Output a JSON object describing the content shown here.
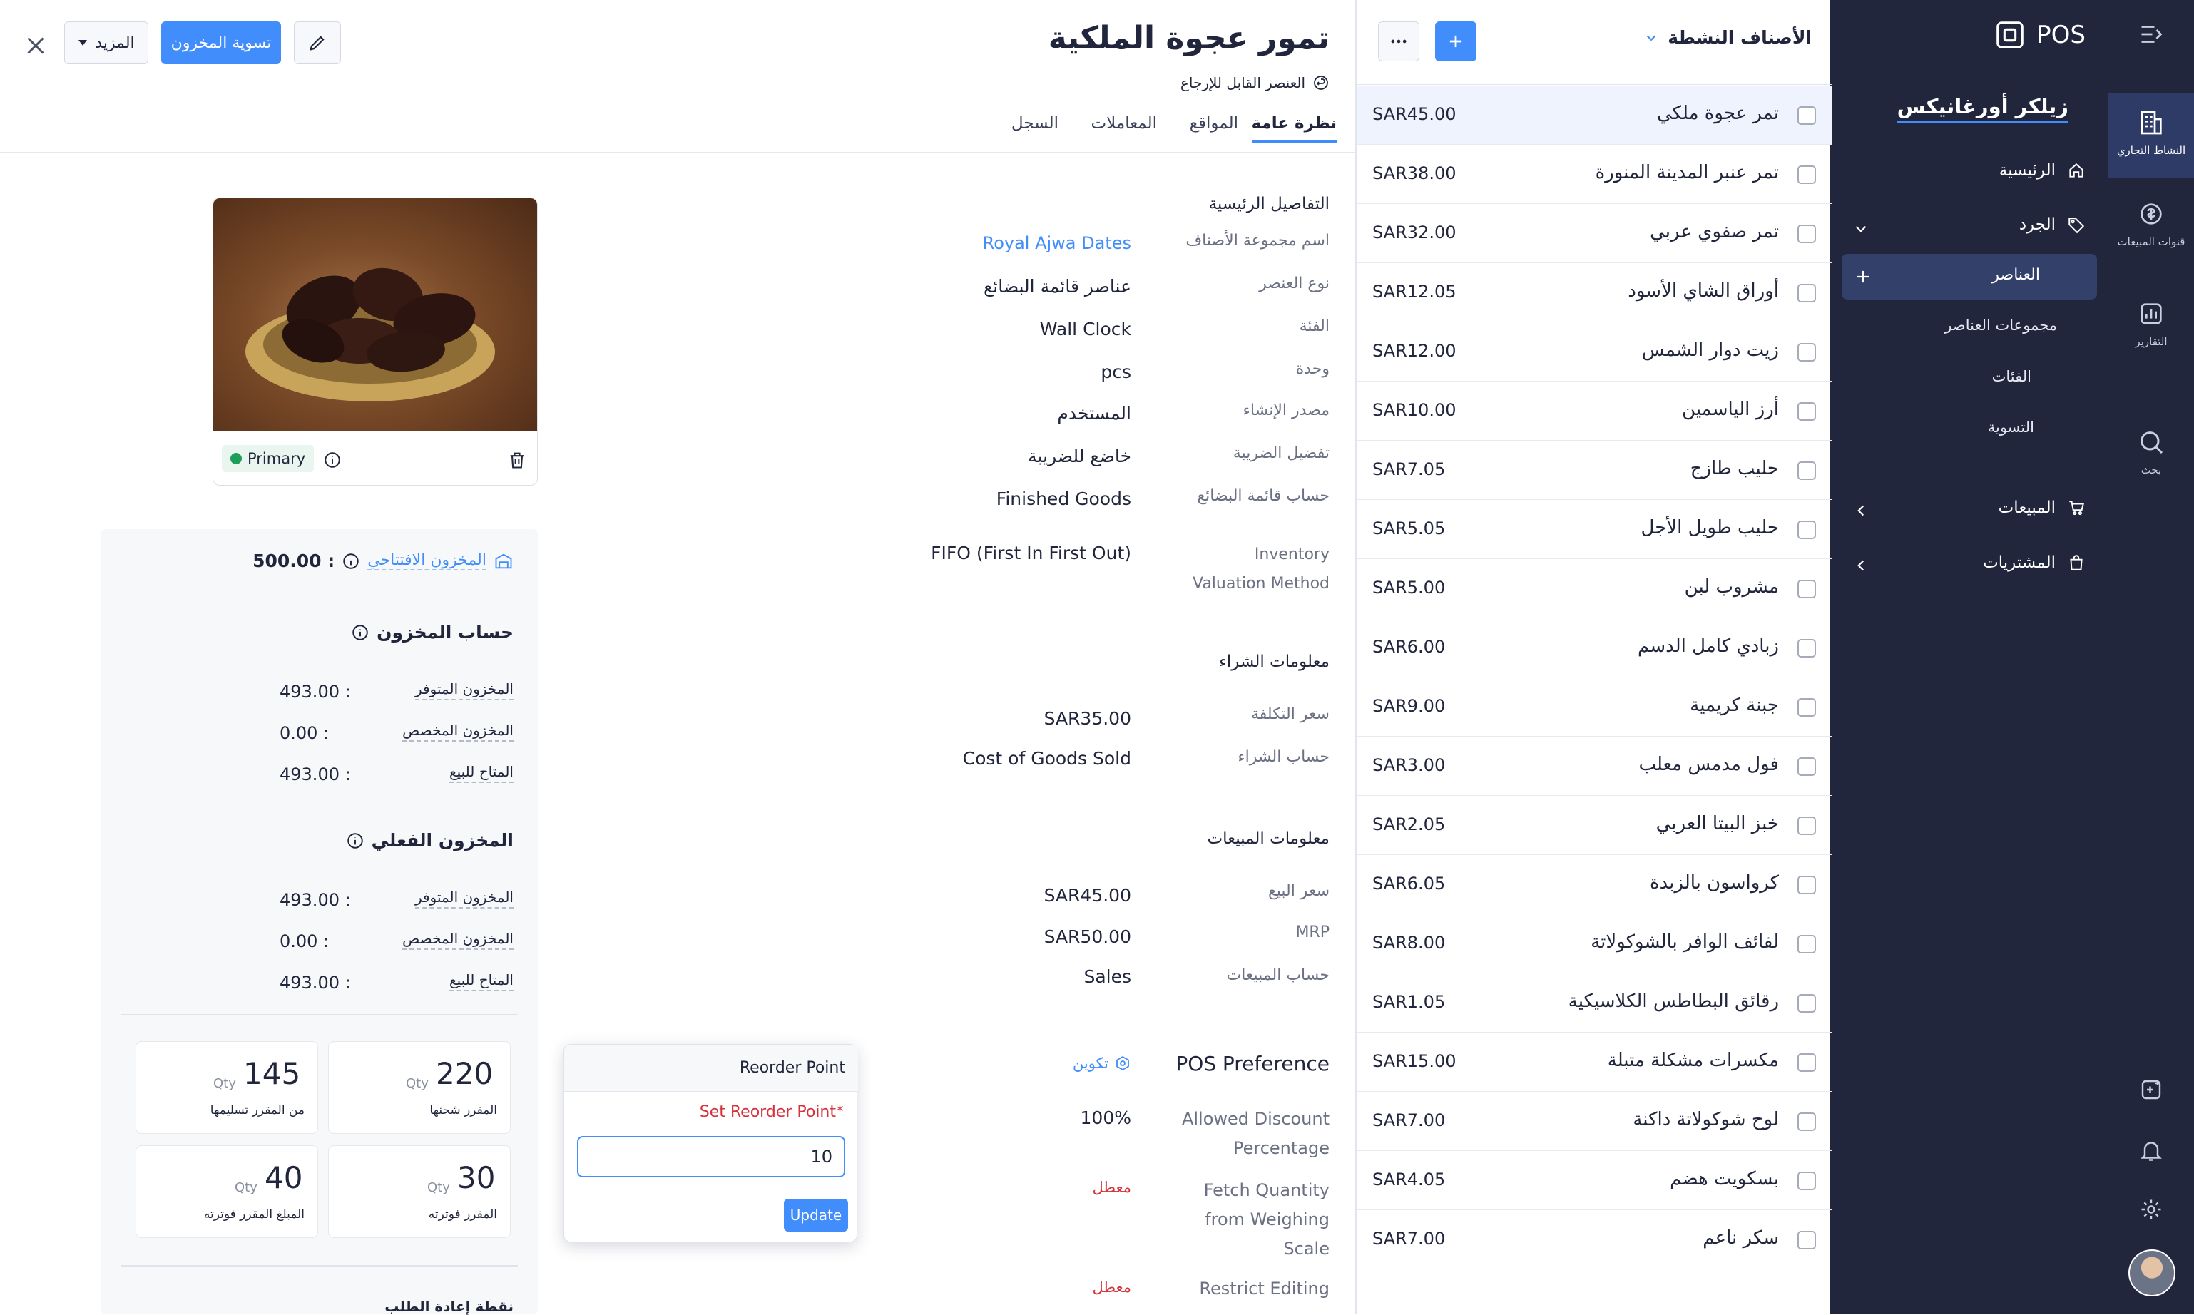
{
  "rail": {
    "items": [
      {
        "label": "النشاط التجاري",
        "icon": "building-icon"
      },
      {
        "label": "قنوات المبيعات",
        "icon": "sales-channel-icon"
      },
      {
        "label": "التقارير",
        "icon": "report-icon"
      },
      {
        "label": "بحث",
        "icon": "search-icon"
      }
    ]
  },
  "nav": {
    "logo": "POS",
    "org": "زيلكر أورغانيكس",
    "home": "الرئيسية",
    "inventory": "الجرد",
    "items": "العناصر",
    "item_groups": "مجموعات العناصر",
    "categories": "الفئات",
    "adjustments": "التسوية",
    "sales": "المبيعات",
    "purchases": "المشتريات"
  },
  "list": {
    "filter": "الأصناف النشطة",
    "rows": [
      {
        "name": "تمر عجوة ملكي",
        "price": "SAR45.00"
      },
      {
        "name": "تمر عنبر المدينة المنورة",
        "price": "SAR38.00"
      },
      {
        "name": "تمر صفوي عربي",
        "price": "SAR32.00"
      },
      {
        "name": "أوراق الشاي الأسود",
        "price": "SAR12.05"
      },
      {
        "name": "زيت دوار الشمس",
        "price": "SAR12.00"
      },
      {
        "name": "أرز الياسمين",
        "price": "SAR10.00"
      },
      {
        "name": "حليب طازج",
        "price": "SAR7.05"
      },
      {
        "name": "حليب طويل الأجل",
        "price": "SAR5.05"
      },
      {
        "name": "مشروب لبن",
        "price": "SAR5.00"
      },
      {
        "name": "زبادي كامل الدسم",
        "price": "SAR6.00"
      },
      {
        "name": "جبنة كريمية",
        "price": "SAR9.00"
      },
      {
        "name": "فول مدمس معلب",
        "price": "SAR3.00"
      },
      {
        "name": "خبز البيتا العربي",
        "price": "SAR2.05"
      },
      {
        "name": "كرواسون بالزبدة",
        "price": "SAR6.05"
      },
      {
        "name": "لفائف الوافر بالشوكولاتة",
        "price": "SAR8.00"
      },
      {
        "name": "رقائق البطاطس الكلاسيكية",
        "price": "SAR1.05"
      },
      {
        "name": "مكسرات مشكلة متبلة",
        "price": "SAR15.00"
      },
      {
        "name": "لوح شوكولاتة داكنة",
        "price": "SAR7.00"
      },
      {
        "name": "بسكويت هضم",
        "price": "SAR4.05"
      },
      {
        "name": "سكر ناعم",
        "price": "SAR7.00"
      }
    ]
  },
  "detail": {
    "title": "تمور عجوة الملكية",
    "subtitle": "العنصر القابل للإرجاع",
    "more": "المزيد",
    "adjust": "تسوية المخزون",
    "tabs": [
      "نظرة عامة",
      "المواقع",
      "المعاملات",
      "السجل"
    ],
    "primary_section": "التفاصيل الرئيسية",
    "fields": [
      {
        "label": "اسم مجموعة الأصناف",
        "value": "Royal Ajwa Dates"
      },
      {
        "label": "نوع العنصر",
        "value": "عناصر قائمة البضائع"
      },
      {
        "label": "الفئة",
        "value": "Wall Clock"
      },
      {
        "label": "وحدة",
        "value": "pcs"
      },
      {
        "label": "مصدر الإنشاء",
        "value": "المستخدم"
      },
      {
        "label": "تفضيل الضريبة",
        "value": "خاضع للضريبة"
      },
      {
        "label": "حساب قائمة البضائع",
        "value": "Finished Goods"
      }
    ],
    "valuation": {
      "label1": "Inventory",
      "label2": "Valuation Method",
      "value": "FIFO (First In First Out)"
    },
    "purchase_section": "معلومات الشراء",
    "cost_label": "سعر التكلفة",
    "cost": "SAR35.00",
    "purchase_acct_label": "حساب الشراء",
    "purchase_acct": "Cost of Goods Sold",
    "sales_section": "معلومات المبيعات",
    "sell_label": "سعر البيع",
    "sell": "SAR45.00",
    "mrp_label": "MRP",
    "mrp": "SAR50.00",
    "sales_acct_label": "حساب المبيعات",
    "sales_acct": "Sales",
    "pos_title": "POS Preference",
    "configure": "تكوين",
    "discount_l1": "Allowed Discount",
    "discount_l2": "Percentage",
    "discount": "100%",
    "fetch_l1": "Fetch Quantity",
    "fetch_l2": "from Weighing",
    "fetch_l3": "Scale",
    "fetch": "معطل",
    "restrict_l1": "Restrict Editing",
    "restrict": "معطل"
  },
  "stock": {
    "primary_badge": "Primary",
    "opening_label": "المخزون الافتتاحي",
    "opening": "500.00 :",
    "account_title": "حساب المخزون",
    "physical_title": "المخزون الفعلي",
    "account_rows": [
      {
        "label": "المخزون المتوفر",
        "value": "493.00 :"
      },
      {
        "label": "المخزون المخصص",
        "value": "0.00 :"
      },
      {
        "label": "المتاح للبيع",
        "value": "493.00 :"
      }
    ],
    "physical_rows": [
      {
        "label": "المخزون المتوفر",
        "value": "493.00 :"
      },
      {
        "label": "المخزون المخصص",
        "value": "0.00 :"
      },
      {
        "label": "المتاح للبيع",
        "value": "493.00 :"
      }
    ],
    "cards": [
      {
        "n": "220",
        "q": "Qty",
        "c": "المقرر شحنها"
      },
      {
        "n": "145",
        "q": "Qty",
        "c": "من المقرر تسليمها"
      },
      {
        "n": "30",
        "q": "Qty",
        "c": "المقرر فوترته"
      },
      {
        "n": "40",
        "q": "Qty",
        "c": "المبلغ المقرر فوترته"
      }
    ],
    "reorder_label": "نقطة إعادة الطلب"
  },
  "popup": {
    "title": "Reorder Point",
    "label": "Set Reorder Point*",
    "value": "10",
    "button": "Update"
  },
  "colors": {
    "primary": "#408dfb",
    "nav": "#21263c",
    "danger": "#d6323c",
    "link": "#408dfb"
  }
}
